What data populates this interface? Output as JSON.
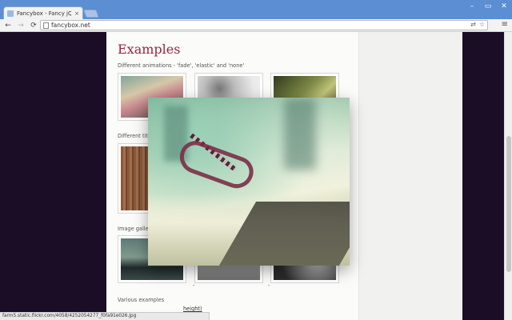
{
  "browser": {
    "tab_title": "Fancybox - Fancy jQuery",
    "tab_close": "×",
    "url": "fancybox.net",
    "window_controls": {
      "minimize": "–",
      "maximize": "▭",
      "close": "✕"
    },
    "nav": {
      "back": "←",
      "forward": "→",
      "reload": "⟳",
      "menu": "≡"
    },
    "omnibox_right_icons": [
      "⇄",
      "☆"
    ]
  },
  "page": {
    "heading": "Examples",
    "sections": {
      "animations": "Different animations - 'fade', 'elastic' and 'none'",
      "titles_partial": "Different titl",
      "galleries_partial": "Image galle",
      "various": "Various examples",
      "height_link": "height)"
    },
    "gallery_captions": [
      "-",
      "-"
    ]
  },
  "status_url": "farm5.static.flickr.com/4058/4252054277_f0fa91e026.jpg",
  "colors": {
    "heading": "#9b2440",
    "page_background": "#1b0d26",
    "titlebar": "#5b8ed3"
  }
}
